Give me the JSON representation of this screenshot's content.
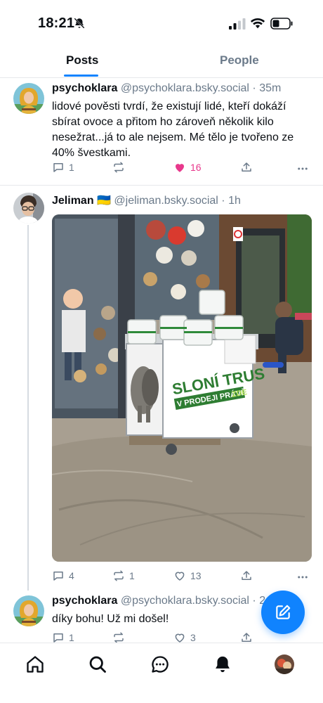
{
  "status_bar": {
    "time": "18:21"
  },
  "tabs": [
    {
      "label": "Posts",
      "active": true
    },
    {
      "label": "People",
      "active": false
    }
  ],
  "posts": [
    {
      "author": "psychoklara",
      "handle": "@psychoklara.bsky.social",
      "separator": "·",
      "time": "35m",
      "text": "lidové pověsti tvrdí, že existují lidé, kteří dokáží sbírat ovoce a přitom ho zároveň několik kilo nesežrat...já to ale nejsem. Mé tělo je tvořeno ze 40% švestkami.",
      "replies": "1",
      "reposts": "",
      "likes": "16",
      "liked": true
    },
    {
      "author": "Jeliman 🇺🇦",
      "handle": "@jeliman.bsky.social",
      "separator": "·",
      "time": "1h",
      "image_sign": {
        "line1": "SLONÍ TRUS",
        "line2": "V PRODEJI PRÁVĚ",
        "line2_tail": "ZDE"
      },
      "replies": "4",
      "reposts": "1",
      "likes": "13",
      "liked": false
    },
    {
      "author": "psychoklara",
      "handle": "@psychoklara.bsky.social",
      "separator": "·",
      "time": "2",
      "text": "díky bohu! Už mi došel!",
      "replies": "1",
      "reposts": "",
      "likes": "3",
      "liked": false
    }
  ],
  "colors": {
    "accent": "#1083fe",
    "like": "#e8388c",
    "muted": "#6b7a8a",
    "sign_green": "#2e7d32"
  },
  "icons": [
    "bell-slash-icon",
    "signal-icon",
    "wifi-icon",
    "battery-icon",
    "reply-icon",
    "repost-icon",
    "heart-icon",
    "share-icon",
    "more-icon",
    "compose-icon",
    "home-icon",
    "search-icon",
    "chat-icon",
    "notifications-icon",
    "profile-avatar"
  ]
}
